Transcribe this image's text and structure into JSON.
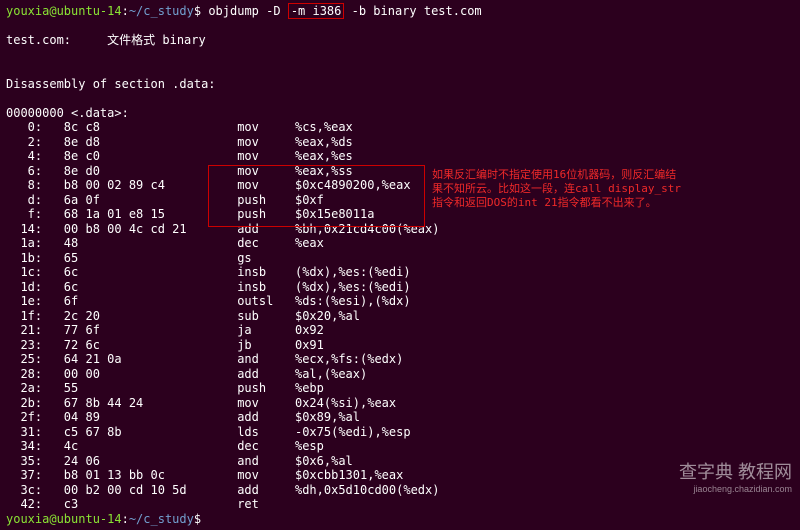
{
  "prompt": {
    "user": "youxia@ubuntu-14",
    "sep": ":",
    "path": "~/c_study",
    "sym": "$"
  },
  "command": {
    "prefix": "objdump -D ",
    "highlight": "-m i386",
    "suffix": " -b binary test.com"
  },
  "file_line": "test.com:     文件格式 binary",
  "disasm_header": "Disassembly of section .data:",
  "section_label": "00000000 <.data>:",
  "rows": [
    {
      "a": "   0:",
      "b": "8c c8",
      "m": "mov",
      "o": "%cs,%eax"
    },
    {
      "a": "   2:",
      "b": "8e d8",
      "m": "mov",
      "o": "%eax,%ds"
    },
    {
      "a": "   4:",
      "b": "8e c0",
      "m": "mov",
      "o": "%eax,%es"
    },
    {
      "a": "   6:",
      "b": "8e d0",
      "m": "mov",
      "o": "%eax,%ss"
    },
    {
      "a": "   8:",
      "b": "b8 00 02 89 c4",
      "m": "mov",
      "o": "$0xc4890200,%eax"
    },
    {
      "a": "   d:",
      "b": "6a 0f",
      "m": "push",
      "o": "$0xf"
    },
    {
      "a": "   f:",
      "b": "68 1a 01 e8 15",
      "m": "push",
      "o": "$0x15e8011a"
    },
    {
      "a": "  14:",
      "b": "00 b8 00 4c cd 21",
      "m": "add",
      "o": "%bh,0x21cd4c00(%eax)"
    },
    {
      "a": "  1a:",
      "b": "48",
      "m": "dec",
      "o": "%eax"
    },
    {
      "a": "  1b:",
      "b": "65",
      "m": "gs",
      "o": ""
    },
    {
      "a": "  1c:",
      "b": "6c",
      "m": "insb",
      "o": "(%dx),%es:(%edi)"
    },
    {
      "a": "  1d:",
      "b": "6c",
      "m": "insb",
      "o": "(%dx),%es:(%edi)"
    },
    {
      "a": "  1e:",
      "b": "6f",
      "m": "outsl",
      "o": "%ds:(%esi),(%dx)"
    },
    {
      "a": "  1f:",
      "b": "2c 20",
      "m": "sub",
      "o": "$0x20,%al"
    },
    {
      "a": "  21:",
      "b": "77 6f",
      "m": "ja",
      "o": "0x92"
    },
    {
      "a": "  23:",
      "b": "72 6c",
      "m": "jb",
      "o": "0x91"
    },
    {
      "a": "  25:",
      "b": "64 21 0a",
      "m": "and",
      "o": "%ecx,%fs:(%edx)"
    },
    {
      "a": "  28:",
      "b": "00 00",
      "m": "add",
      "o": "%al,(%eax)"
    },
    {
      "a": "  2a:",
      "b": "55",
      "m": "push",
      "o": "%ebp"
    },
    {
      "a": "  2b:",
      "b": "67 8b 44 24",
      "m": "mov",
      "o": "0x24(%si),%eax"
    },
    {
      "a": "  2f:",
      "b": "04 89",
      "m": "add",
      "o": "$0x89,%al"
    },
    {
      "a": "  31:",
      "b": "c5 67 8b",
      "m": "lds",
      "o": "-0x75(%edi),%esp"
    },
    {
      "a": "  34:",
      "b": "4c",
      "m": "dec",
      "o": "%esp"
    },
    {
      "a": "  35:",
      "b": "24 06",
      "m": "and",
      "o": "$0x6,%al"
    },
    {
      "a": "  37:",
      "b": "b8 01 13 bb 0c",
      "m": "mov",
      "o": "$0xcbb1301,%eax"
    },
    {
      "a": "  3c:",
      "b": "00 b2 00 cd 10 5d",
      "m": "add",
      "o": "%dh,0x5d10cd00(%edx)"
    },
    {
      "a": "  42:",
      "b": "c3",
      "m": "ret",
      "o": ""
    }
  ],
  "annotation": {
    "l1": "如果反汇编时不指定使用16位机器码，则反汇编结",
    "l2": "果不知所云。比如这一段，连call display_str",
    "l3": "指令和返回DOS的int 21指令都看不出来了。"
  },
  "watermark": {
    "main": "查字典  教程网",
    "sub": "jiaocheng.chazidian.com"
  }
}
